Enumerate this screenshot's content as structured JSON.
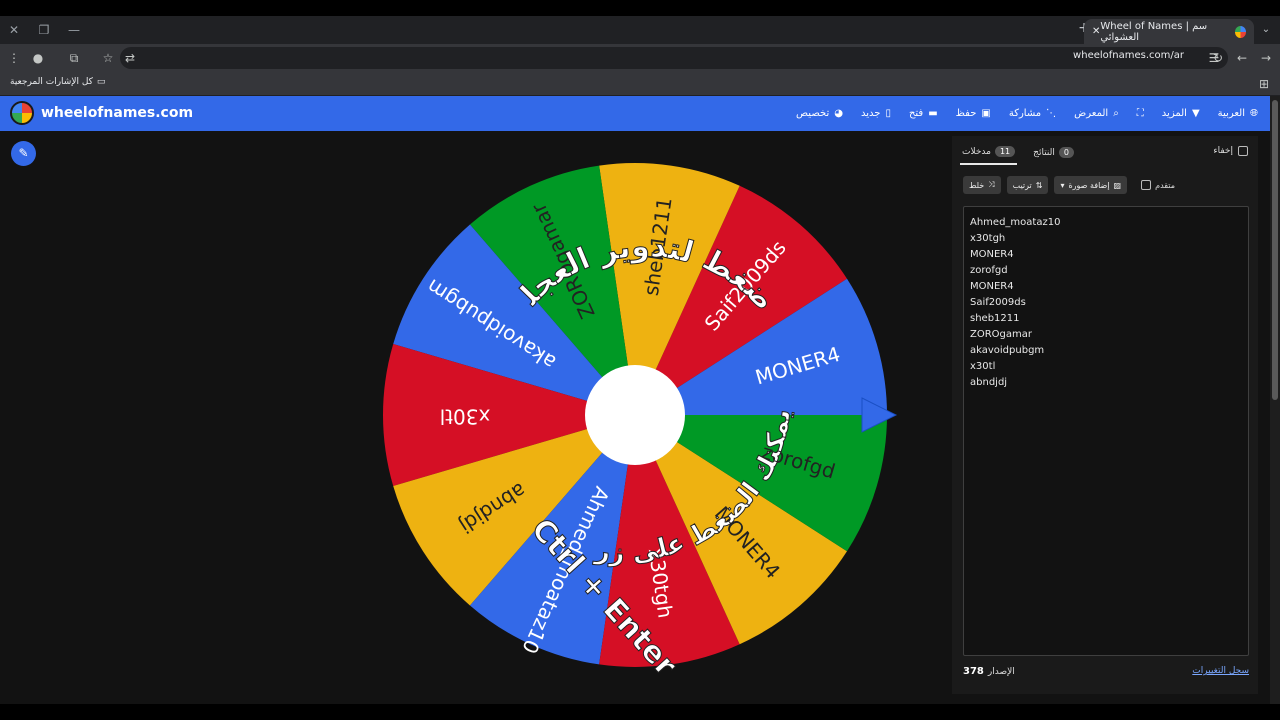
{
  "browser": {
    "tab_title": "Wheel of Names | سم العشوائي",
    "url": "wheelofnames.com/ar",
    "bookmarks_label": "كل الإشارات المرجعية"
  },
  "header": {
    "brand": "wheelofnames.com",
    "menu": [
      {
        "label": "العربية",
        "icon": "globe-icon"
      },
      {
        "label": "المزيد",
        "icon": "chevron-down-icon"
      },
      {
        "label": "",
        "icon": "fullscreen-icon"
      },
      {
        "label": "المعرض",
        "icon": "search-icon"
      },
      {
        "label": "مشاركة",
        "icon": "share-icon"
      },
      {
        "label": "حفظ",
        "icon": "save-icon"
      },
      {
        "label": "فتح",
        "icon": "folder-icon"
      },
      {
        "label": "جديد",
        "icon": "new-file-icon"
      },
      {
        "label": "تخصيص",
        "icon": "palette-icon"
      }
    ]
  },
  "wheel": {
    "overlay_top": "إضغط لتدوير العجلة",
    "overlay_bottom_1": "أو يمكنك الضغط على زر",
    "overlay_bottom_2": "Ctrl + Enter",
    "segments": [
      {
        "label": "Saif2009ds",
        "color": "#d50f25"
      },
      {
        "label": "sheb1211",
        "color": "#eeb211"
      },
      {
        "label": "ZOROgamar",
        "color": "#009925"
      },
      {
        "label": "akavoidpubgm",
        "color": "#3369e8"
      },
      {
        "label": "x30tl",
        "color": "#d50f25"
      },
      {
        "label": "abndjdj",
        "color": "#eeb211"
      },
      {
        "label": "Ahmed_moataz10",
        "color": "#3369e8"
      },
      {
        "label": "x30tgh",
        "color": "#d50f25"
      },
      {
        "label": "MONER4",
        "color": "#eeb211"
      },
      {
        "label": "zorofgd",
        "color": "#009925"
      },
      {
        "label": "MONER4",
        "color": "#3369e8"
      }
    ]
  },
  "panel": {
    "hide_label": "إخفاء",
    "tab_entries": "مدخلات",
    "entries_count": "11",
    "tab_results": "النتائج",
    "results_count": "0",
    "shuffle_label": "خلط",
    "sort_label": "ترتيب",
    "add_image_label": "إضافة صورة",
    "advanced_label": "متقدم",
    "entries": [
      "Ahmed_moataz10",
      "x30tgh",
      "MONER4",
      "zorofgd",
      "MONER4",
      "Saif2009ds",
      "sheb1211",
      "ZOROgamar",
      "akavoidpubgm",
      "x30tl",
      "abndjdj"
    ],
    "changelog_label": "سجل التغييرات",
    "version_label": "الإصدار",
    "version_number": "378"
  }
}
